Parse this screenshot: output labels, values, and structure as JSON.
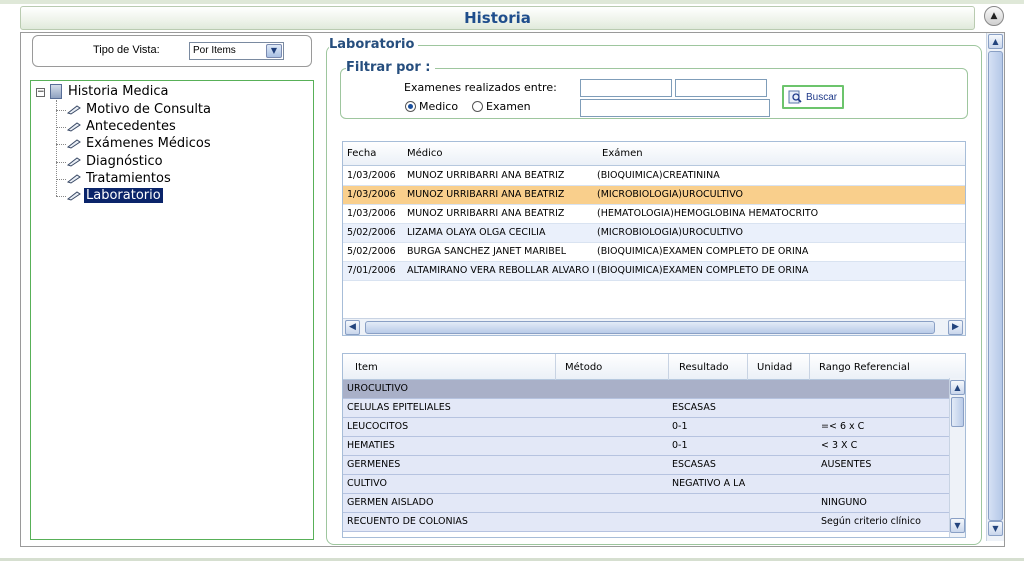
{
  "header": {
    "title": "Historia"
  },
  "vista": {
    "label": "Tipo de Vista:",
    "selected": "Por Items"
  },
  "tree": {
    "root": "Historia Medica",
    "items": [
      {
        "label": "Motivo de Consulta"
      },
      {
        "label": "Antecedentes"
      },
      {
        "label": "Exámenes Médicos"
      },
      {
        "label": "Diagnóstico"
      },
      {
        "label": "Tratamientos"
      },
      {
        "label": "Laboratorio"
      }
    ]
  },
  "laboratorio": {
    "legend": "Laboratorio",
    "filter": {
      "legend": "Filtrar por :",
      "range_label": "Examenes realizados entre:",
      "radio_medico": "Medico",
      "radio_examen": "Examen",
      "selected_radio": "Medico",
      "date_from": "",
      "date_to": "",
      "search_value": "",
      "button": "Buscar"
    }
  },
  "exams_grid": {
    "headers": [
      "Fecha",
      "Médico",
      "Exámen"
    ],
    "rows": [
      [
        "1/03/2006",
        "MUÑOZ URRIBARRI ANA BEATRIZ",
        "(BIOQUIMICA)CREATININA"
      ],
      [
        "1/03/2006",
        "MUÑOZ URRIBARRI ANA BEATRIZ",
        "(MICROBIOLOGIA)UROCULTIVO"
      ],
      [
        "1/03/2006",
        "MUÑOZ URRIBARRI ANA BEATRIZ",
        "(HEMATOLOGIA)HEMOGLOBINA HEMATOCRITO"
      ],
      [
        "5/02/2006",
        "LIZAMA OLAYA OLGA CECILIA",
        "(MICROBIOLOGIA)UROCULTIVO"
      ],
      [
        "5/02/2006",
        "BURGA SANCHEZ JANET MARIBEL",
        "(BIOQUIMICA)EXAMEN COMPLETO DE ORINA"
      ],
      [
        "7/01/2006",
        "ALTAMIRANO VERA REBOLLAR ALVARO I",
        "(BIOQUIMICA)EXAMEN COMPLETO DE ORINA"
      ]
    ],
    "selected_row": 1
  },
  "results_grid": {
    "headers": [
      "Item",
      "Método",
      "Resultado",
      "Unidad",
      "Rango Referencial"
    ],
    "group": "UROCULTIVO",
    "rows": [
      [
        "CELULAS EPITELIALES",
        "",
        "ESCASAS",
        "",
        ""
      ],
      [
        "LEUCOCITOS",
        "",
        "0-1",
        "",
        "=< 6 x C"
      ],
      [
        "HEMATIES",
        "",
        "0-1",
        "",
        "< 3 X C"
      ],
      [
        "GERMENES",
        "",
        "ESCASAS",
        "",
        "AUSENTES"
      ],
      [
        "CULTIVO",
        "",
        "NEGATIVO A LA",
        "",
        ""
      ],
      [
        "GERMEN AISLADO",
        "",
        "",
        "",
        "NINGUNO"
      ],
      [
        "RECUENTO DE COLONIAS",
        "",
        "",
        "",
        "Según criterio clínico"
      ]
    ]
  },
  "colors": {
    "title": "#1f4e8c",
    "selected_row": "#f9cf8c",
    "tree_selected": "#0a246a",
    "panel_border": "#58b058"
  }
}
